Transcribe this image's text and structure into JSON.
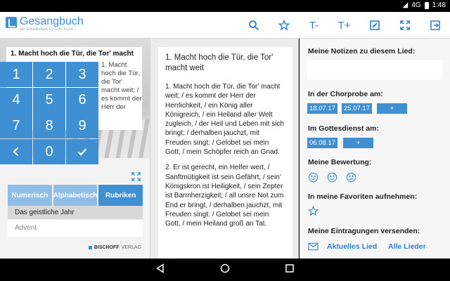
{
  "status": {
    "network": "4G",
    "time": "1:48"
  },
  "app": {
    "title": "Gesangbuch",
    "subtitle": "der Selbständigen Ev.-Luth. Kirche"
  },
  "toolbar": {
    "font_smaller": "T-",
    "font_larger": "T+"
  },
  "song": {
    "title": "1. Macht hoch die Tür, die Tor' macht",
    "snippet": "1. Macht hoch die Tür, die Tor' macht weit; / es kommt der Herr der",
    "full_title": "1. Macht hoch die Tür, die Tor' macht weit",
    "verses": [
      "1. Macht hoch die Tür, die Tor' macht weit; / es kommt der Herr der Herrlichkeit, / ein König aller Königreich, / ein Heiland aller Welt zugleich, / der Heil und Leben mit sich bringt; / derhalben jauchzt, mit Freuden singt: / Gelobet sei mein Gott, / mein Schöpfer reich an Gnad.",
      "2. Er ist gerecht, ein Helfer wert, / Sanftmütigkeit ist sein Gefährt, / sein' Königskron ist Heiligkeit, / sein Zepter ist Barmherzigkeit; / all unsre Not zum End er bringt, / derhalben jauchzt, mit Freuden singt: / Gelobet sei mein Gott, / mein Heiland groß an Tat."
    ]
  },
  "numpad": {
    "keys": [
      "1",
      "2",
      "3",
      "4",
      "5",
      "6",
      "7",
      "8",
      "9",
      "",
      "0",
      ""
    ]
  },
  "index_tabs": [
    "Numerisch",
    "Alphabetisch",
    "Rubriken"
  ],
  "category": {
    "header": "Das geistliche Jahr",
    "item": "Advent"
  },
  "publisher": {
    "name": "BISCHOFF",
    "suffix": "VERLAG"
  },
  "notes": {
    "my_notes_label": "Meine Notizen zu diesem Lied:",
    "rehearsal_label": "In der Chorprobe am:",
    "rehearsal_dates": [
      "18.07.17",
      "25.07.17"
    ],
    "service_label": "Im Gottesdienst am:",
    "service_dates": [
      "06.08.17"
    ],
    "add": "+",
    "rating_label": "Meine Bewertung:",
    "favorites_label": "In meine Favoriten aufnehmen:",
    "send_label": "Meine Eintragungen versenden:",
    "send_current": "Aktuelles Lied",
    "send_all": "Alle Lieder"
  },
  "colors": {
    "accent": "#3f8fd3",
    "tab_inactive": "#8fbde6"
  }
}
